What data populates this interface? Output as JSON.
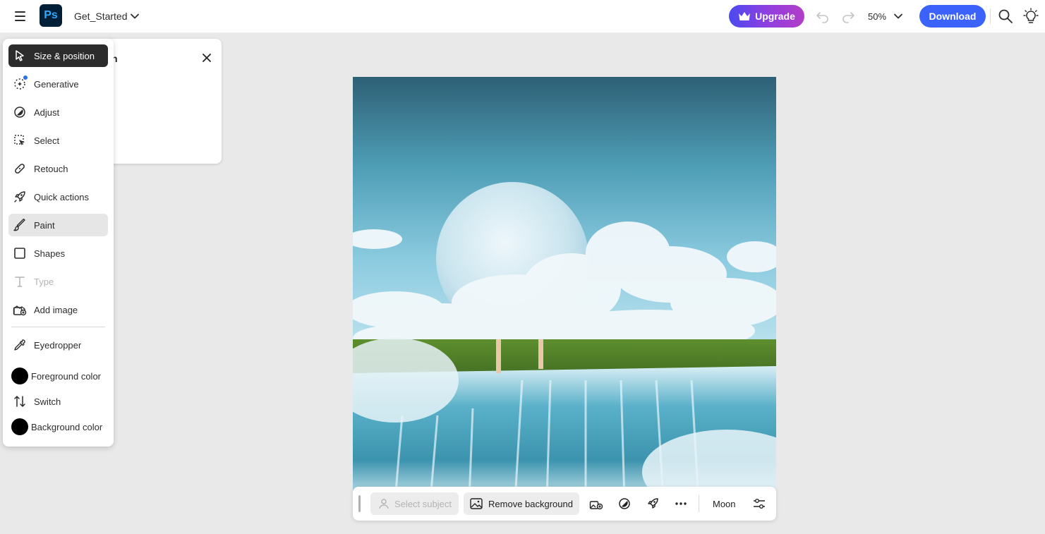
{
  "topbar": {
    "document_name": "Get_Started",
    "upgrade_label": "Upgrade",
    "zoom_level": "50%",
    "download_label": "Download"
  },
  "panel": {
    "title_fragment": "n"
  },
  "tools": [
    {
      "label": "Size & position",
      "icon": "pointer-icon",
      "state": "active"
    },
    {
      "label": "Generative",
      "icon": "generative-icon",
      "state": "normal"
    },
    {
      "label": "Adjust",
      "icon": "adjust-icon",
      "state": "normal"
    },
    {
      "label": "Select",
      "icon": "select-icon",
      "state": "normal"
    },
    {
      "label": "Retouch",
      "icon": "bandage-icon",
      "state": "normal"
    },
    {
      "label": "Quick actions",
      "icon": "rocket-icon",
      "state": "normal"
    },
    {
      "label": "Paint",
      "icon": "brush-icon",
      "state": "hover"
    },
    {
      "label": "Shapes",
      "icon": "square-icon",
      "state": "normal"
    },
    {
      "label": "Type",
      "icon": "type-icon",
      "state": "disabled"
    },
    {
      "label": "Add image",
      "icon": "add-image-icon",
      "state": "normal"
    },
    {
      "label": "Eyedropper",
      "icon": "eyedropper-icon",
      "state": "normal"
    },
    {
      "label": "Foreground color",
      "icon": "swatch",
      "state": "normal"
    },
    {
      "label": "Switch",
      "icon": "switch-arrows-icon",
      "state": "normal"
    },
    {
      "label": "Background color",
      "icon": "swatch",
      "state": "normal"
    }
  ],
  "colors": {
    "foreground": "#000000",
    "background": "#000000",
    "accent": "#3b63fb"
  },
  "taskbar": {
    "select_subject_label": "Select subject",
    "remove_background_label": "Remove background",
    "layer_name": "Moon"
  }
}
